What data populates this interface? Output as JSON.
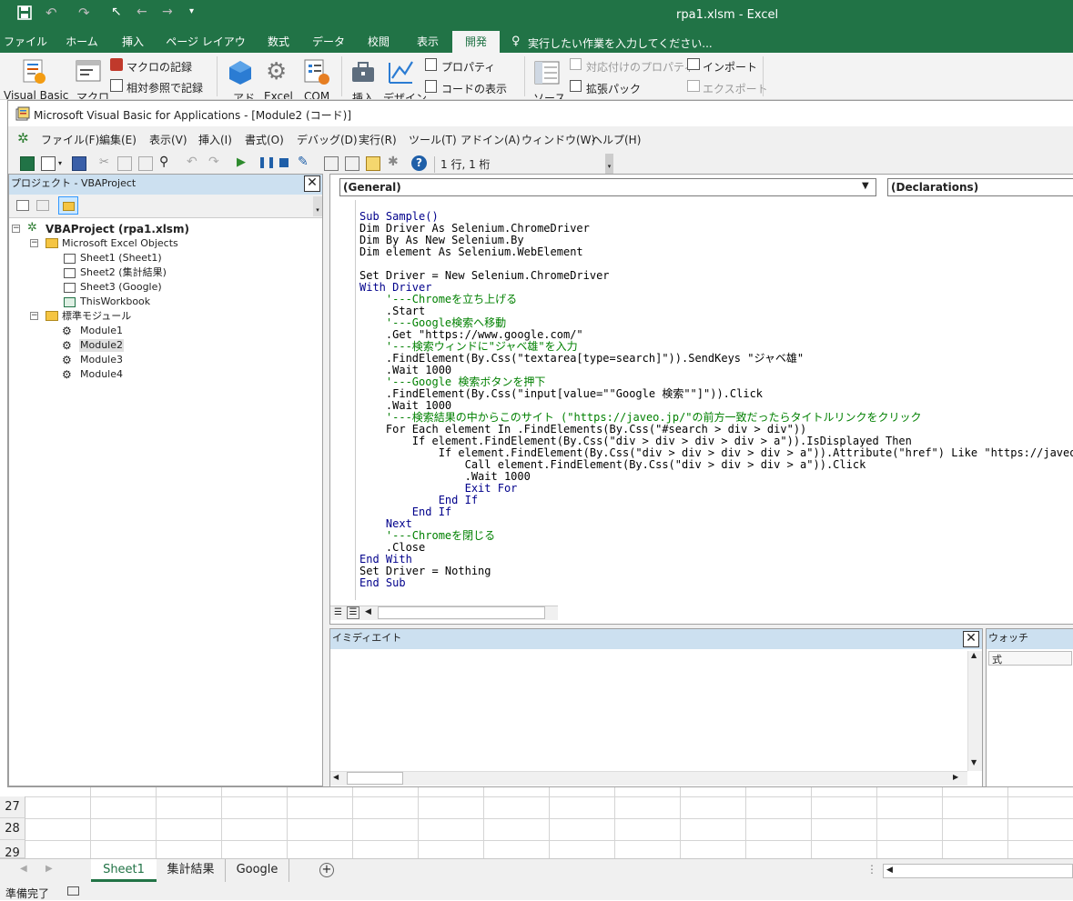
{
  "excel": {
    "title": "rpa1.xlsm - Excel",
    "tabs": [
      "ファイル",
      "ホーム",
      "挿入",
      "ページ レイアウト",
      "数式",
      "データ",
      "校閲",
      "表示",
      "開発"
    ],
    "active_tab": "開発",
    "tell_me": "実行したい作業を入力してください...",
    "ribbon": {
      "visual_basic": "Visual Basic",
      "macro": "マクロ",
      "record_macro": "マクロの記録",
      "relative_ref": "相対参照で記録",
      "addins": "アド",
      "excel_addins": "Excel",
      "com_addins": "COM",
      "insert": "挿入",
      "design": "デザイン",
      "properties": "プロパティ",
      "view_code": "コードの表示",
      "source": "ソース",
      "map_props": "対応付けのプロパティ",
      "expansion": "拡張パック",
      "import": "インポート",
      "export": "エクスポート"
    },
    "rows": [
      "27",
      "28",
      "29"
    ],
    "sheet_tabs": [
      "Sheet1",
      "集計結果",
      "Google"
    ],
    "active_sheet": "Sheet1",
    "status": "準備完了"
  },
  "vbe": {
    "title": "Microsoft Visual Basic for Applications - [Module2 (コード)]",
    "menu": [
      "ファイル(F)",
      "編集(E)",
      "表示(V)",
      "挿入(I)",
      "書式(O)",
      "デバッグ(D)",
      "実行(R)",
      "ツール(T)",
      "アドイン(A)",
      "ウィンドウ(W)",
      "ヘルプ(H)"
    ],
    "position": "1 行, 1 桁",
    "project": {
      "header": "プロジェクト - VBAProject",
      "root": "VBAProject (rpa1.xlsm)",
      "objects_folder": "Microsoft Excel Objects",
      "objects": [
        "Sheet1 (Sheet1)",
        "Sheet2 (集計結果)",
        "Sheet3 (Google)",
        "ThisWorkbook"
      ],
      "modules_folder": "標準モジュール",
      "modules": [
        "Module1",
        "Module2",
        "Module3",
        "Module4"
      ]
    },
    "combo_left": "(General)",
    "combo_right": "(Declarations)",
    "code_lines": [
      {
        "t": "Sub Sample()",
        "c": "kw"
      },
      {
        "t": "Dim Driver As Selenium.ChromeDriver",
        "c": ""
      },
      {
        "t": "Dim By As New Selenium.By",
        "c": ""
      },
      {
        "t": "Dim element As Selenium.WebElement",
        "c": ""
      },
      {
        "t": "",
        "c": ""
      },
      {
        "t": "Set Driver = New Selenium.ChromeDriver",
        "c": ""
      },
      {
        "t": "With Driver",
        "c": "kw"
      },
      {
        "t": "    '---Chromeを立ち上げる",
        "c": "cm"
      },
      {
        "t": "    .Start",
        "c": ""
      },
      {
        "t": "    '---Google検索へ移動",
        "c": "cm"
      },
      {
        "t": "    .Get \"https://www.google.com/\"",
        "c": ""
      },
      {
        "t": "    '---検索ウィンドに\"ジャベ雄\"を入力",
        "c": "cm"
      },
      {
        "t": "    .FindElement(By.Css(\"textarea[type=search]\")).SendKeys \"ジャベ雄\"",
        "c": ""
      },
      {
        "t": "    .Wait 1000",
        "c": ""
      },
      {
        "t": "    '---Google 検索ボタンを押下",
        "c": "cm"
      },
      {
        "t": "    .FindElement(By.Css(\"input[value=\"\"Google 検索\"\"]\")).Click",
        "c": ""
      },
      {
        "t": "    .Wait 1000",
        "c": ""
      },
      {
        "t": "    '---検索結果の中からこのサイト (\"https://javeo.jp/\"の前方一致だったらタイトルリンクをクリック",
        "c": "cm"
      },
      {
        "t": "    For Each element In .FindElements(By.Css(\"#search > div > div\"))",
        "c": ""
      },
      {
        "t": "        If element.FindElement(By.Css(\"div > div > div > div > a\")).IsDisplayed Then",
        "c": ""
      },
      {
        "t": "            If element.FindElement(By.Css(\"div > div > div > div > a\")).Attribute(\"href\") Like \"https://javeo.jp",
        "c": ""
      },
      {
        "t": "                Call element.FindElement(By.Css(\"div > div > div > a\")).Click",
        "c": ""
      },
      {
        "t": "                .Wait 1000",
        "c": ""
      },
      {
        "t": "                Exit For",
        "c": "kw"
      },
      {
        "t": "            End If",
        "c": "kw"
      },
      {
        "t": "        End If",
        "c": "kw"
      },
      {
        "t": "    Next",
        "c": "kw"
      },
      {
        "t": "    '---Chromeを閉じる",
        "c": "cm"
      },
      {
        "t": "    .Close",
        "c": ""
      },
      {
        "t": "End With",
        "c": "kw"
      },
      {
        "t": "Set Driver = Nothing",
        "c": ""
      },
      {
        "t": "End Sub",
        "c": "kw"
      }
    ],
    "immediate": "イミディエイト",
    "watch": "ウォッチ",
    "watch_col": "式"
  }
}
